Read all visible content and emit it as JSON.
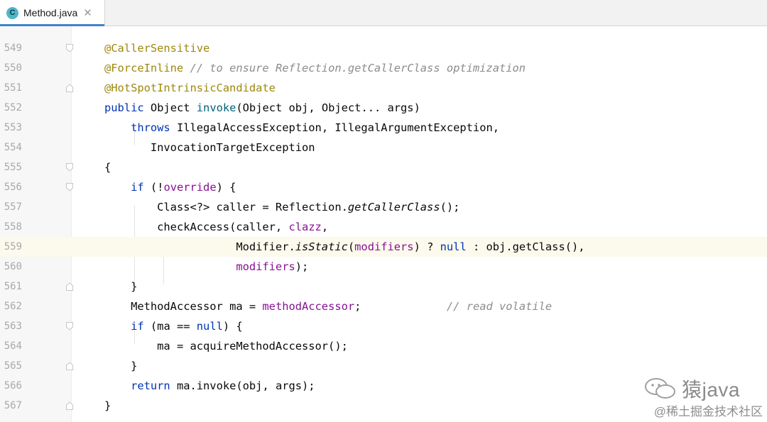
{
  "tab": {
    "icon_letter": "C",
    "filename": "Method.java",
    "close_glyph": "✕"
  },
  "lines": [
    {
      "n": "549"
    },
    {
      "n": "550"
    },
    {
      "n": "551"
    },
    {
      "n": "552"
    },
    {
      "n": "553"
    },
    {
      "n": "554"
    },
    {
      "n": "555"
    },
    {
      "n": "556"
    },
    {
      "n": "557"
    },
    {
      "n": "558"
    },
    {
      "n": "559"
    },
    {
      "n": "560"
    },
    {
      "n": "561"
    },
    {
      "n": "562"
    },
    {
      "n": "563"
    },
    {
      "n": "564"
    },
    {
      "n": "565"
    },
    {
      "n": "566"
    },
    {
      "n": "567"
    }
  ],
  "code": {
    "l549": {
      "a": "@CallerSensitive"
    },
    "l550": {
      "a": "@ForceInline",
      "c": "// to ensure Reflection.getCallerClass optimization"
    },
    "l551": {
      "a": "@HotSpotIntrinsicCandidate"
    },
    "l552": {
      "kw": "public",
      "t1": "Object",
      "fn": "invoke",
      "t2": "(Object obj, Object... args)"
    },
    "l553": {
      "kw": "throws",
      "t": "IllegalAccessException, IllegalArgumentException,"
    },
    "l554": {
      "t": "InvocationTargetException"
    },
    "l555": {
      "t": "{"
    },
    "l556": {
      "kw": "if",
      "t1": "(!",
      "f": "override",
      "t2": ") {"
    },
    "l557": {
      "t1": "Class<?> caller = Reflection.",
      "i": "getCallerClass",
      "t2": "();"
    },
    "l558": {
      "t1": "checkAccess(caller, ",
      "f": "clazz",
      "t2": ","
    },
    "l559": {
      "t1": "Modifier.",
      "i": "isStatic",
      "t2": "(",
      "f": "modifiers",
      "t3": ") ? ",
      "kw": "null",
      "t4": " : obj.getClass(),"
    },
    "l560": {
      "f": "modifiers",
      "t": ");"
    },
    "l561": {
      "t": "}"
    },
    "l562": {
      "t": "MethodAccessor ma = ",
      "f": "methodAccessor",
      "t2": ";",
      "c": "// read volatile"
    },
    "l563": {
      "kw": "if",
      "t1": "(ma == ",
      "kw2": "null",
      "t2": ") {"
    },
    "l564": {
      "t": "ma = acquireMethodAccessor();"
    },
    "l565": {
      "t": "}"
    },
    "l566": {
      "kw": "return",
      "t": "ma.invoke(obj, args);"
    },
    "l567": {
      "t": "}"
    }
  },
  "watermark": {
    "channel": "猿java",
    "site": "@稀土掘金技术社区"
  },
  "colors": {
    "annotation": "#9e880d",
    "keyword": "#0033b3",
    "method": "#00627a",
    "field": "#871094",
    "comment": "#8c8c8c",
    "current_line": "#fcfaed"
  }
}
